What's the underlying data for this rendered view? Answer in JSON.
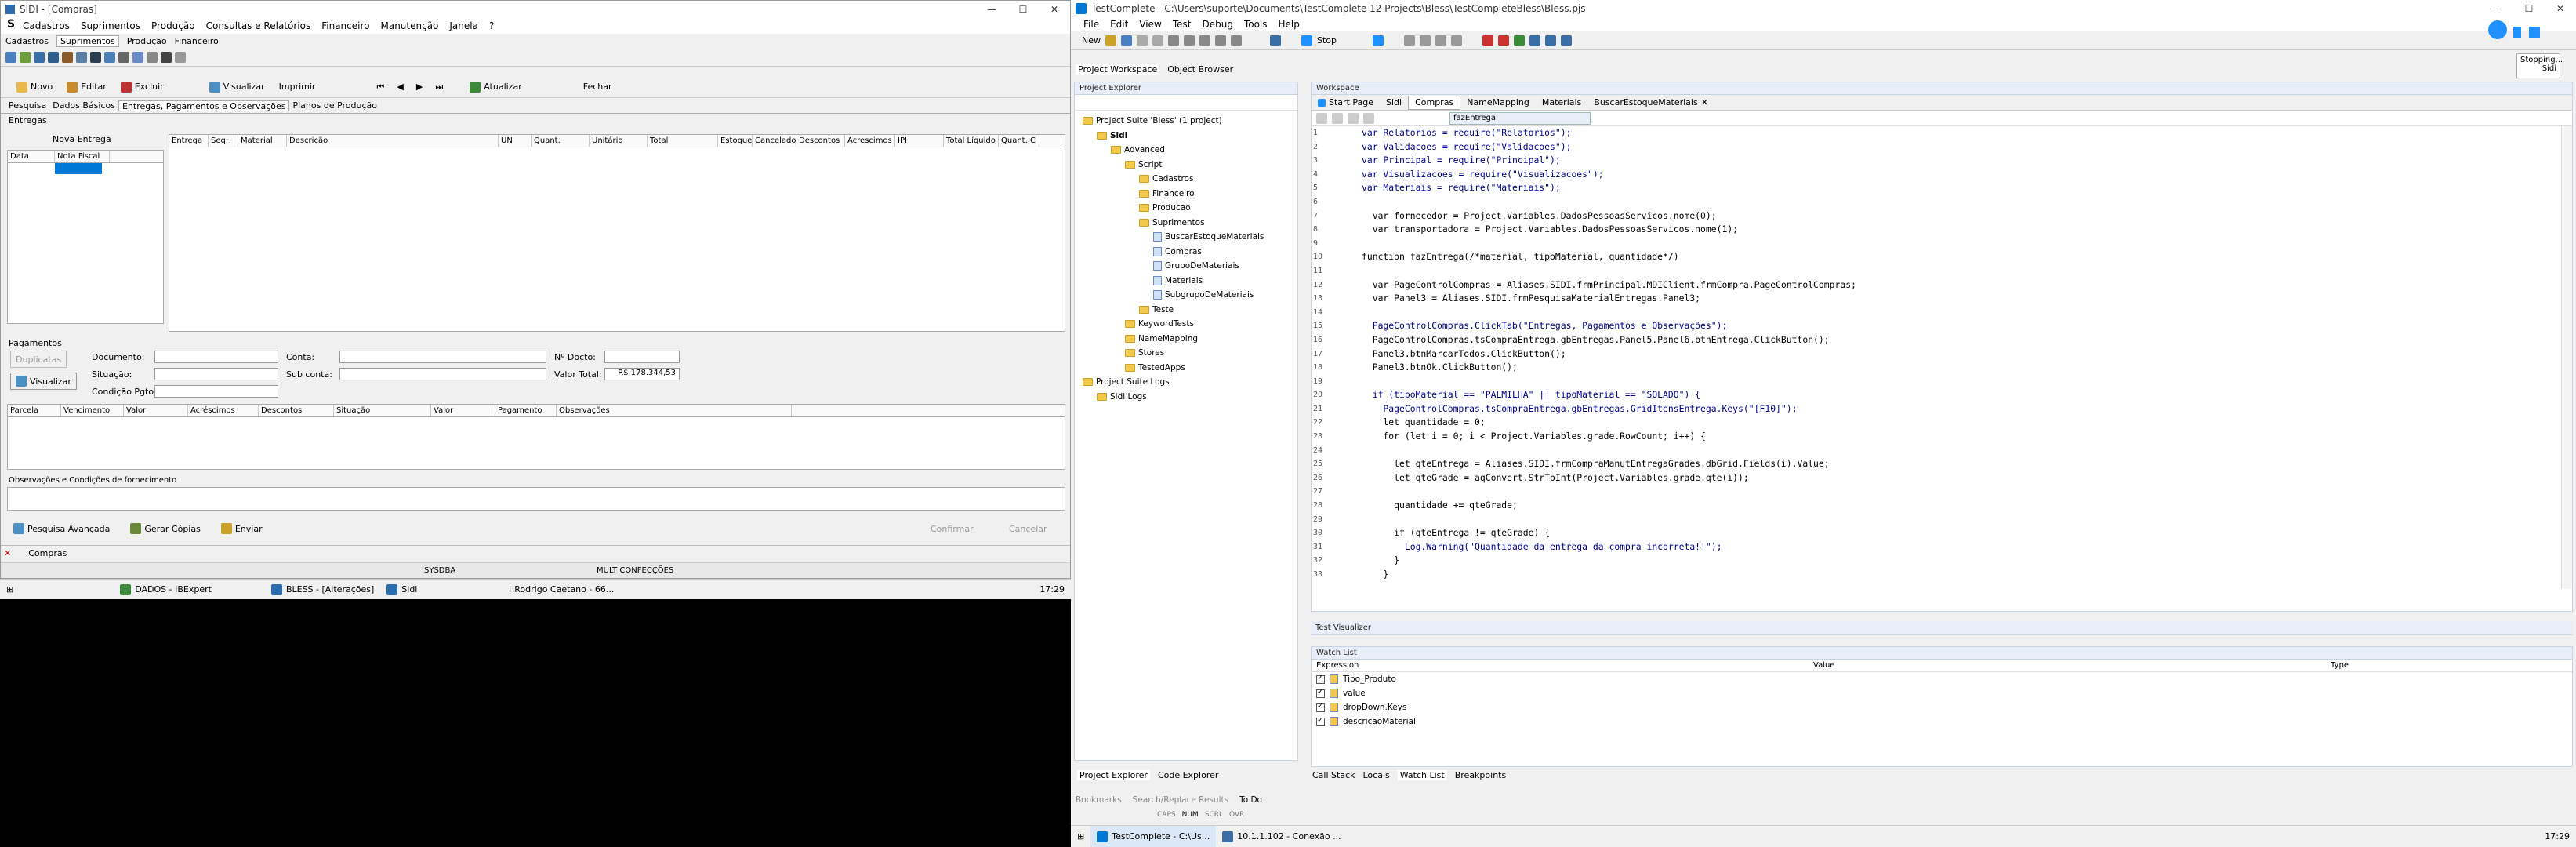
{
  "left_app": {
    "title": "SIDI - [Compras]",
    "menu": [
      "Cadastros",
      "Suprimentos",
      "Produção",
      "Consultas e Relatórios",
      "Financeiro",
      "Manutenção",
      "Janela",
      "?"
    ],
    "module_tabs": [
      "Cadastros",
      "Suprimentos",
      "Produção",
      "Financeiro"
    ],
    "toolbar": {
      "novo": "Novo",
      "editar": "Editar",
      "excluir": "Excluir",
      "visualizar": "Visualizar",
      "imprimir": "Imprimir",
      "atualizar": "Atualizar",
      "fechar": "Fechar"
    },
    "tabs": [
      "Pesquisa",
      "Dados Básicos",
      "Entregas, Pagamentos e Observações",
      "Planos de Produção"
    ],
    "entregas_label": "Entregas",
    "nova_entrega": "Nova Entrega",
    "entrega_cols": [
      "Data",
      "Nota Fiscal"
    ],
    "itens_cols": [
      "Entrega",
      "Seq.",
      "Material",
      "Descrição",
      "UN",
      "Quant.",
      "Unitário",
      "Total",
      "Estoque",
      "Cancelado",
      "Descontos",
      "Acrescimos",
      "IPI",
      "Total Líquido",
      "Quant. C"
    ],
    "pagamentos": {
      "label": "Pagamentos",
      "duplicatas": "Duplicatas",
      "visualizar": "Visualizar",
      "documento": "Documento:",
      "situacao": "Situação:",
      "condicao": "Condição Pgto:",
      "conta": "Conta:",
      "subconta": "Sub conta:",
      "ndocto": "Nº Docto:",
      "valor_total_label": "Valor Total:",
      "valor_total": "R$ 178.344,53",
      "cols": [
        "Parcela",
        "Vencimento",
        "Valor",
        "Acréscimos",
        "Descontos",
        "Situação",
        "Valor",
        "Pagamento",
        "Observações"
      ]
    },
    "obs_label": "Observações e Condições de fornecimento",
    "bottom": {
      "pesquisa": "Pesquisa Avançada",
      "gerar": "Gerar Cópias",
      "enviar": "Enviar",
      "confirmar": "Confirmar",
      "cancelar": "Cancelar"
    },
    "doc_tab": "Compras",
    "status": [
      "SYSDBA",
      "MULT CONFECÇÕES"
    ],
    "taskbar": {
      "items": [
        "DADOS - IBExpert",
        "BLESS - [Alterações]",
        "Sidi",
        "! Rodrigo Caetano - 66..."
      ],
      "time": "17:29"
    }
  },
  "right_app": {
    "title": "TestComplete - C:\\Users\\suporte\\Documents\\TestComplete 12 Projects\\Bless\\TestCompleteBless\\Bless.pjs",
    "menu": [
      "File",
      "Edit",
      "View",
      "Test",
      "Debug",
      "Tools",
      "Help"
    ],
    "toolbar": {
      "new": "New",
      "stop": "Stop"
    },
    "stopping": {
      "title": "Stopping...",
      "sub": "Sidi"
    },
    "workspace_tabs": [
      "Project Workspace",
      "Object Browser"
    ],
    "project_explorer_label": "Project Explorer",
    "tree": [
      {
        "label": "Project Suite 'Bless' (1 project)",
        "indent": 0,
        "kind": "suite"
      },
      {
        "label": "Sidi",
        "indent": 1,
        "kind": "project"
      },
      {
        "label": "Advanced",
        "indent": 2,
        "kind": "folder"
      },
      {
        "label": "Script",
        "indent": 3,
        "kind": "folder"
      },
      {
        "label": "Cadastros",
        "indent": 4,
        "kind": "folder"
      },
      {
        "label": "Financeiro",
        "indent": 4,
        "kind": "folder"
      },
      {
        "label": "Producao",
        "indent": 4,
        "kind": "folder"
      },
      {
        "label": "Suprimentos",
        "indent": 4,
        "kind": "folder"
      },
      {
        "label": "BuscarEstoqueMateriais",
        "indent": 5,
        "kind": "unit"
      },
      {
        "label": "Compras",
        "indent": 5,
        "kind": "unit"
      },
      {
        "label": "GrupoDeMateriais",
        "indent": 5,
        "kind": "unit"
      },
      {
        "label": "Materiais",
        "indent": 5,
        "kind": "unit"
      },
      {
        "label": "SubgrupoDeMateriais",
        "indent": 5,
        "kind": "unit"
      },
      {
        "label": "Teste",
        "indent": 4,
        "kind": "folder"
      },
      {
        "label": "KeywordTests",
        "indent": 3,
        "kind": "folder"
      },
      {
        "label": "NameMapping",
        "indent": 3,
        "kind": "item"
      },
      {
        "label": "Stores",
        "indent": 3,
        "kind": "item"
      },
      {
        "label": "TestedApps",
        "indent": 3,
        "kind": "item"
      },
      {
        "label": "Project Suite Logs",
        "indent": 0,
        "kind": "folder"
      },
      {
        "label": "Sidi Logs",
        "indent": 1,
        "kind": "item"
      }
    ],
    "left_bottom_tabs": [
      "Project Explorer",
      "Code Explorer"
    ],
    "workspace_label": "Workspace",
    "editor_tabs": [
      "Start Page",
      "Sidi",
      "Compras",
      "NameMapping",
      "Materiais",
      "BuscarEstoqueMateriais"
    ],
    "function_combo": "fazEntrega",
    "code": [
      "var Relatorios = require(\"Relatorios\");",
      "var Validacoes = require(\"Validacoes\");",
      "var Principal = require(\"Principal\");",
      "var Visualizacoes = require(\"Visualizacoes\");",
      "var Materiais = require(\"Materiais\");",
      "",
      "  var fornecedor = Project.Variables.DadosPessoasServicos.nome(0);",
      "  var transportadora = Project.Variables.DadosPessoasServicos.nome(1);",
      "",
      "function fazEntrega(/*material, tipoMaterial, quantidade*/) ",
      "",
      "  var PageControlCompras = Aliases.SIDI.frmPrincipal.MDIClient.frmCompra.PageControlCompras;",
      "  var Panel3 = Aliases.SIDI.frmPesquisaMaterialEntregas.Panel3;",
      "",
      "  PageControlCompras.ClickTab(\"Entregas, Pagamentos e Observações\");",
      "  PageControlCompras.tsCompraEntrega.gbEntregas.Panel5.Panel6.btnEntrega.ClickButton();",
      "  Panel3.btnMarcarTodos.ClickButton();",
      "  Panel3.btnOk.ClickButton();",
      "",
      "  if (tipoMaterial == \"PALMILHA\" || tipoMaterial == \"SOLADO\") {",
      "    PageControlCompras.tsCompraEntrega.gbEntregas.GridItensEntrega.Keys(\"[F10]\");",
      "    let quantidade = 0;",
      "    for (let i = 0; i < Project.Variables.grade.RowCount; i++) {",
      "",
      "      let qteEntrega = Aliases.SIDI.frmCompraManutEntregaGrades.dbGrid.Fields(i).Value;",
      "      let qteGrade = aqConvert.StrToInt(Project.Variables.grade.qte(i));",
      "",
      "      quantidade += qteGrade;",
      "",
      "      if (qteEntrega != qteGrade) {",
      "        Log.Warning(\"Quantidade da entrega da compra incorreta!!\");",
      "      }",
      "    }"
    ],
    "test_visualizer": "Test Visualizer",
    "watch_list": {
      "label": "Watch List",
      "cols": [
        "Expression",
        "Value",
        "Type"
      ],
      "rows": [
        "Tipo_Produto",
        "value",
        "dropDown.Keys",
        "descricaoMaterial"
      ]
    },
    "bottom_tabs": [
      "Call Stack",
      "Locals",
      "Watch List",
      "Breakpoints"
    ],
    "lower_tabs": [
      "Bookmarks",
      "Search/Replace Results",
      "To Do"
    ],
    "status": [
      "CAPS",
      "NUM",
      "SCRL",
      "OVR"
    ],
    "taskbar": {
      "items": [
        "TestComplete - C:\\Us...",
        "10.1.1.102 - Conexão ..."
      ],
      "time": "17:29"
    }
  }
}
